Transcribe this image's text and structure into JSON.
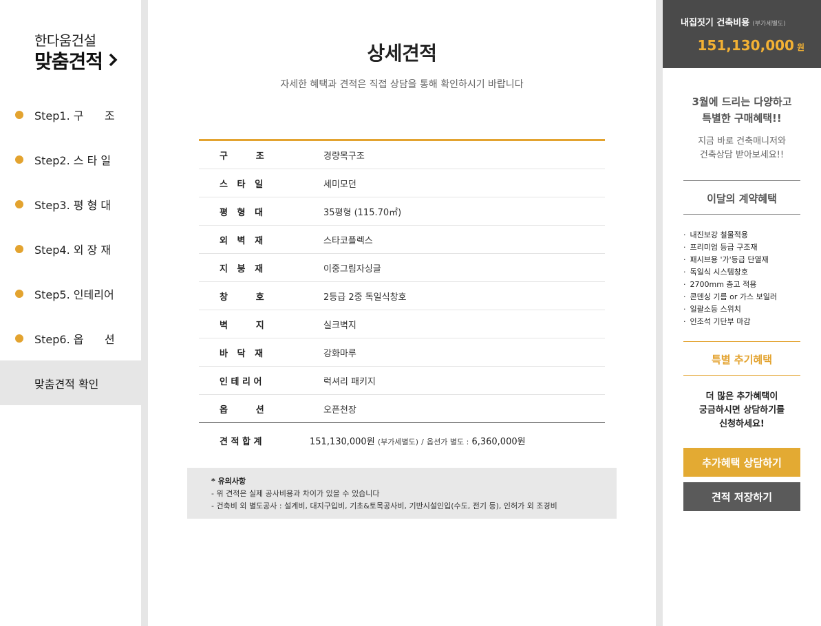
{
  "sidebar": {
    "brand_sub": "한다움건설",
    "brand_main": "맞춤견적",
    "steps": [
      {
        "label": "Step1. 구      조"
      },
      {
        "label": "Step2. 스 타 일"
      },
      {
        "label": "Step3. 평 형 대"
      },
      {
        "label": "Step4. 외 장 재"
      },
      {
        "label": "Step5. 인테리어"
      },
      {
        "label": "Step6. 옵      션"
      }
    ],
    "confirm_label": "맞춤견적 확인"
  },
  "main": {
    "title": "상세견적",
    "subtitle": "자세한 혜택과 견적은 직접 상담을 통해 확인하시기 바랍니다",
    "rows": [
      {
        "label": "구         조",
        "value": "경량목구조"
      },
      {
        "label": "스   타   일",
        "value": "세미모던"
      },
      {
        "label": "평   형   대",
        "value": "35평형 (115.70㎡)"
      },
      {
        "label": "외   벽   재",
        "value": "스타코플렉스"
      },
      {
        "label": "지   붕   재",
        "value": "이중그림자싱글"
      },
      {
        "label": "창         호",
        "value": "2등급 2중 독일식창호"
      },
      {
        "label": "벽         지",
        "value": "실크벽지"
      },
      {
        "label": "바   닥   재",
        "value": "강화마루"
      },
      {
        "label": "인 테 리 어",
        "value": "럭셔리 패키지"
      },
      {
        "label": "옵         션",
        "value": "오픈천장"
      }
    ],
    "total_label": "견 적 합 계",
    "total_price": "151,130,000원",
    "total_vat": "(부가세별도)",
    "total_sep": "/",
    "total_option_label": "옵션가 별도 :",
    "total_option_price": "6,360,000원",
    "notice_title": "* 유의사항",
    "notice_lines": [
      "- 위 견적은 실제 공사비용과 차이가 있을 수 있습니다",
      "- 건축비 외 별도공사 : 설계비, 대지구입비, 기초&토목공사비, 기반시설인입(수도, 전기 등), 인허가 외 조경비"
    ]
  },
  "right": {
    "cost_label": "내집짓기 건축비용",
    "cost_vat": "(부가세별도)",
    "cost_value": "151,130,000",
    "cost_unit": "원",
    "promo_line1": "3월에 드리는 다양하고",
    "promo_line2": "특별한 구매혜택!!",
    "promo_sub1": "지금 바로 건축매니저와",
    "promo_sub2": "건축상담 받아보세요!!",
    "monthly_title": "이달의 계약혜택",
    "benefits": [
      "내진보강 철물적용",
      "프리미엄 등급 구조재",
      "패시브용 '가'등급 단열재",
      "독일식 시스템창호",
      "2700mm 층고 적용",
      "콘덴싱 기름 or 가스 보일러",
      "일괄소등 스위치",
      "인조석 기단부 마감"
    ],
    "special_title": "특별 추기혜택",
    "extra_line1": "더 많은 추가혜택이",
    "extra_line2": "궁금하시면 상담하기를",
    "extra_line3": "신청하세요!",
    "consult_button": "추가혜택 상담하기",
    "save_button": "견적 저장하기"
  },
  "colors": {
    "accent": "#e3a32f",
    "cost_bg": "#4a4a4a",
    "cost_text": "#f2b134",
    "save_button_bg": "#5a5a5a"
  }
}
